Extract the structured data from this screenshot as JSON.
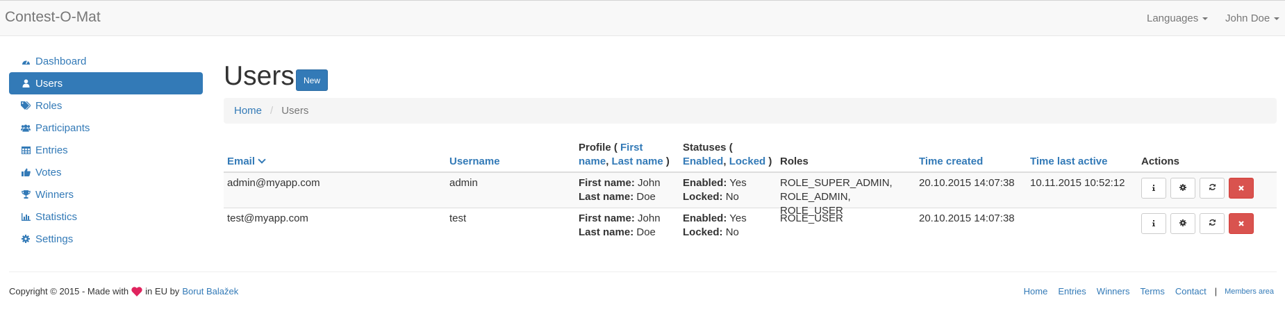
{
  "app": {
    "brand": "Contest-O-Mat"
  },
  "navbar": {
    "languages": "Languages",
    "user": "John Doe"
  },
  "sidebar": {
    "items": [
      {
        "label": "Dashboard",
        "icon": "dashboard-icon",
        "active": false
      },
      {
        "label": "Users",
        "icon": "user-icon",
        "active": true
      },
      {
        "label": "Roles",
        "icon": "tags-icon",
        "active": false
      },
      {
        "label": "Participants",
        "icon": "users-icon",
        "active": false
      },
      {
        "label": "Entries",
        "icon": "table-icon",
        "active": false
      },
      {
        "label": "Votes",
        "icon": "thumbs-up-icon",
        "active": false
      },
      {
        "label": "Winners",
        "icon": "trophy-icon",
        "active": false
      },
      {
        "label": "Statistics",
        "icon": "bar-chart-icon",
        "active": false
      },
      {
        "label": "Settings",
        "icon": "gear-icon",
        "active": false
      }
    ]
  },
  "page": {
    "title": "Users",
    "new_button": "New"
  },
  "breadcrumb": {
    "home": "Home",
    "current": "Users"
  },
  "table": {
    "headers": {
      "email": "Email",
      "username": "Username",
      "profile_prefix": "Profile (",
      "profile_first": "First name",
      "profile_comma": ",",
      "profile_last": "Last name",
      "profile_suffix": ")",
      "statuses_prefix": "Statuses (",
      "statuses_enabled": "Enabled",
      "statuses_comma": ",",
      "statuses_locked": "Locked",
      "statuses_suffix": ")",
      "roles": "Roles",
      "time_created": "Time created",
      "time_last_active": "Time last active",
      "actions": "Actions"
    },
    "labels": {
      "first_name": "First name:",
      "last_name": "Last name:",
      "enabled": "Enabled:",
      "locked": "Locked:"
    },
    "rows": [
      {
        "email": "admin@myapp.com",
        "username": "admin",
        "first_name": "John",
        "last_name": "Doe",
        "enabled": "Yes",
        "locked": "No",
        "roles_line1": "ROLE_SUPER_ADMIN,",
        "roles_line2": "ROLE_ADMIN, ROLE_USER",
        "time_created": "20.10.2015 14:07:38",
        "time_last_active": "10.11.2015 10:52:12"
      },
      {
        "email": "test@myapp.com",
        "username": "test",
        "first_name": "John",
        "last_name": "Doe",
        "enabled": "Yes",
        "locked": "No",
        "roles_line1": "ROLE_USER",
        "roles_line2": "",
        "time_created": "20.10.2015 14:07:38",
        "time_last_active": ""
      }
    ]
  },
  "footer": {
    "copyright_prefix": "Copyright © 2015 - Made with",
    "copyright_middle": "in EU by",
    "author": "Borut Balažek",
    "links": [
      "Home",
      "Entries",
      "Winners",
      "Terms",
      "Contact"
    ],
    "separator": "|",
    "members_area": "Members area"
  },
  "colors": {
    "primary": "#337ab7",
    "danger": "#d9534f",
    "heart": "#e0245e"
  }
}
